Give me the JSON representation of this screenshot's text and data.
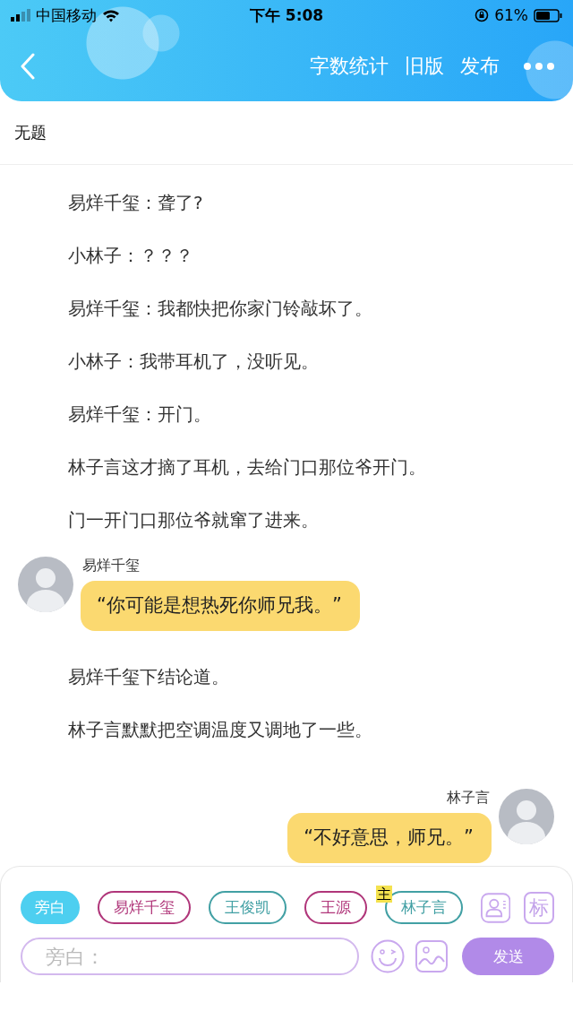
{
  "status_bar": {
    "carrier": "中国移动",
    "time": "下午 5:08",
    "battery": "61%"
  },
  "header": {
    "actions": [
      "字数统计",
      "旧版",
      "发布"
    ]
  },
  "document": {
    "title": "无题"
  },
  "story": [
    {
      "kind": "narration",
      "text": "易烊千玺：聋了?"
    },
    {
      "kind": "narration",
      "text": "小林子：？？？"
    },
    {
      "kind": "narration",
      "text": "易烊千玺：我都快把你家门铃敲坏了。"
    },
    {
      "kind": "narration",
      "text": "小林子：我带耳机了，没听见。"
    },
    {
      "kind": "narration",
      "text": "易烊千玺：开门。"
    },
    {
      "kind": "narration",
      "text": "林子言这才摘了耳机，去给门口那位爷开门。"
    },
    {
      "kind": "narration",
      "text": "门一开门口那位爷就窜了进来。"
    },
    {
      "kind": "left_bubble",
      "speaker": "易烊千玺",
      "text": "“你可能是想热死你师兄我。”"
    },
    {
      "kind": "narration",
      "text": "易烊千玺下结论道。"
    },
    {
      "kind": "narration",
      "text": "林子言默默把空调温度又调地了一些。"
    },
    {
      "kind": "right_bubble",
      "speaker": "林子言",
      "text": "“不好意思，师兄。”"
    }
  ],
  "composer": {
    "roles": [
      {
        "label": "旁白",
        "selected": true,
        "color": "#4dcff0"
      },
      {
        "label": "易烊千玺",
        "selected": false,
        "color": "#b0367a"
      },
      {
        "label": "王俊凯",
        "selected": false,
        "color": "#42a0a4"
      },
      {
        "label": "王源",
        "selected": false,
        "color": "#b0367a"
      },
      {
        "label": "林子言",
        "selected": false,
        "color": "#42a0a4",
        "badge": "主"
      }
    ],
    "tag_button": "标",
    "placeholder": "旁白：",
    "send": "发送"
  }
}
